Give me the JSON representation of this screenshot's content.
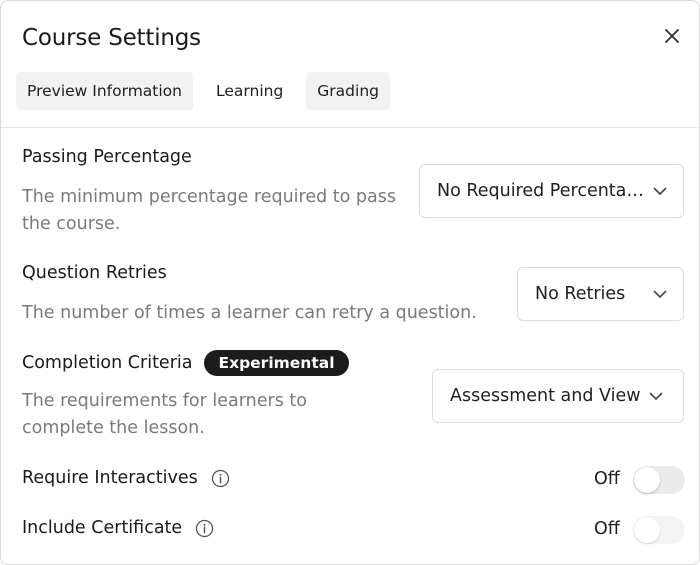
{
  "dialog": {
    "title": "Course Settings"
  },
  "tabs": [
    {
      "label": "Preview Information"
    },
    {
      "label": "Learning"
    },
    {
      "label": "Grading"
    }
  ],
  "passing_percentage": {
    "title": "Passing Percentage",
    "description": "The minimum percentage required to pass the course.",
    "selected": "No Required Percentage"
  },
  "question_retries": {
    "title": "Question Retries",
    "description": "The number of times a learner can retry a question.",
    "selected": "No Retries"
  },
  "completion_criteria": {
    "title": "Completion Criteria",
    "badge": "Experimental",
    "description": "The requirements for learners to complete the lesson.",
    "selected": "Assessment and View"
  },
  "require_interactives": {
    "title": "Require Interactives",
    "state": "Off"
  },
  "include_certificate": {
    "title": "Include Certificate",
    "state": "Off"
  }
}
